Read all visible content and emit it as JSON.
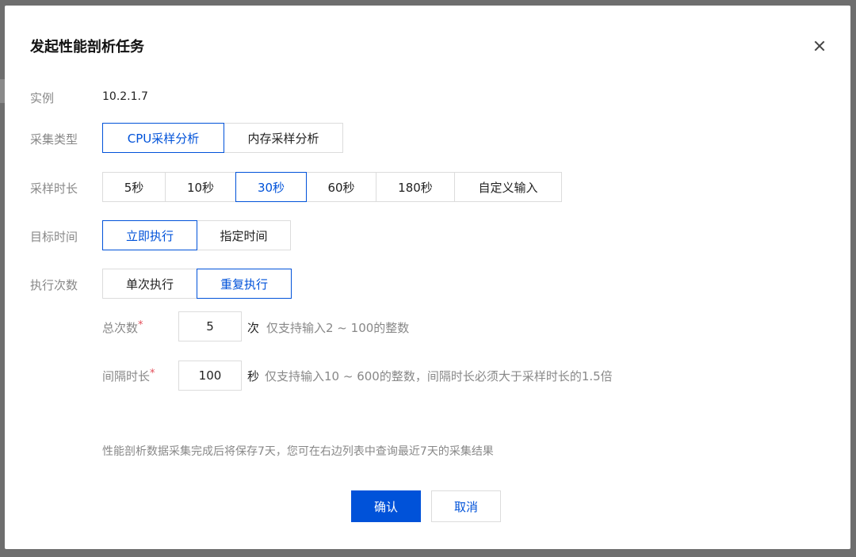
{
  "dialog": {
    "title": "发起性能剖析任务",
    "close_icon": "close-icon"
  },
  "instance": {
    "label": "实例",
    "value": "10.2.1.7"
  },
  "collect_type": {
    "label": "采集类型",
    "options": [
      "CPU采样分析",
      "内存采样分析"
    ],
    "selected": "CPU采样分析"
  },
  "sample_duration": {
    "label": "采样时长",
    "options": [
      "5秒",
      "10秒",
      "30秒",
      "60秒",
      "180秒",
      "自定义输入"
    ],
    "selected": "30秒"
  },
  "target_time": {
    "label": "目标时间",
    "options": [
      "立即执行",
      "指定时间"
    ],
    "selected": "立即执行"
  },
  "exec_count": {
    "label": "执行次数",
    "options": [
      "单次执行",
      "重复执行"
    ],
    "selected": "重复执行"
  },
  "total_count": {
    "label": "总次数",
    "required_mark": "*",
    "value": "5",
    "unit": "次",
    "hint": "仅支持输入2 ~ 100的整数"
  },
  "interval": {
    "label": "间隔时长",
    "required_mark": "*",
    "value": "100",
    "unit": "秒",
    "hint": "仅支持输入10 ~ 600的整数，间隔时长必须大于采样时长的1.5倍"
  },
  "note": "性能剖析数据采集完成后将保存7天，您可在右边列表中查询最近7天的采集结果",
  "footer": {
    "confirm": "确认",
    "cancel": "取消"
  },
  "colors": {
    "primary": "#0052d9",
    "required": "#e34d59"
  }
}
